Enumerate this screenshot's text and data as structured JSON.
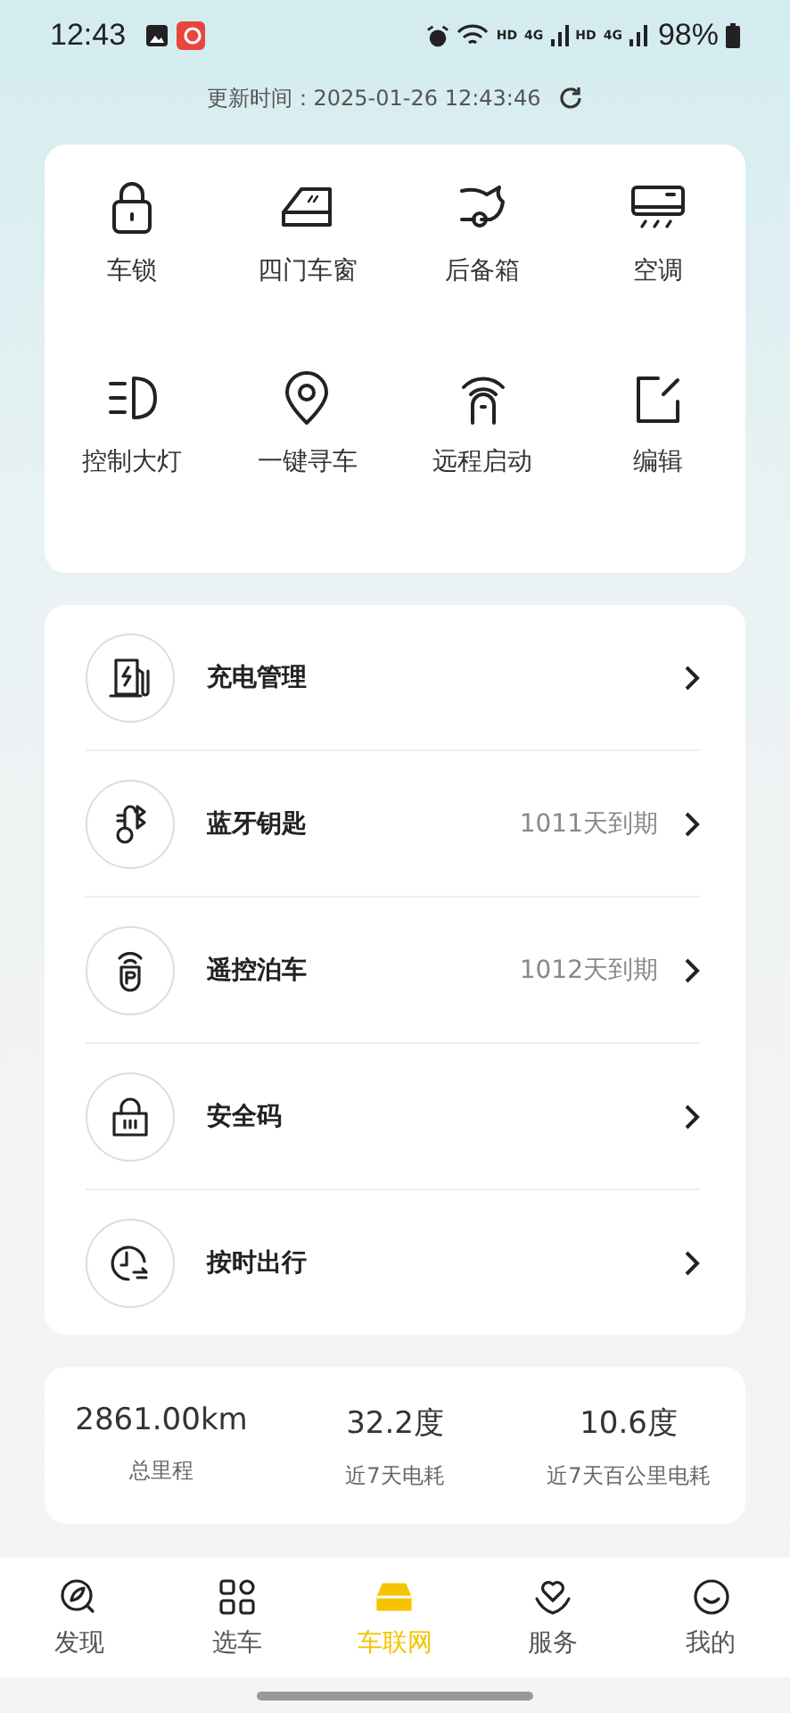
{
  "status_bar": {
    "time": "12:43",
    "battery": "98%",
    "network_labels": [
      "HD",
      "4G",
      "HD",
      "4G"
    ]
  },
  "update_time": {
    "label": "更新时间：2025-01-26 12:43:46"
  },
  "controls": [
    {
      "label": "车锁"
    },
    {
      "label": "四门车窗"
    },
    {
      "label": "后备箱"
    },
    {
      "label": "空调"
    },
    {
      "label": "控制大灯"
    },
    {
      "label": "一键寻车"
    },
    {
      "label": "远程启动"
    },
    {
      "label": "编辑"
    }
  ],
  "services": [
    {
      "label": "充电管理"
    },
    {
      "label": "蓝牙钥匙",
      "note": "1011天到期"
    },
    {
      "label": "遥控泊车",
      "note": "1012天到期"
    },
    {
      "label": "安全码"
    },
    {
      "label": "按时出行"
    }
  ],
  "stats": [
    {
      "value": "2861.00km",
      "label": "总里程"
    },
    {
      "value": "32.2度",
      "label": "近7天电耗"
    },
    {
      "value": "10.6度",
      "label": "近7天百公里电耗"
    }
  ],
  "tab_bar": [
    {
      "label": "发现",
      "selected": false
    },
    {
      "label": "选车",
      "selected": false
    },
    {
      "label": "车联网",
      "selected": true
    },
    {
      "label": "服务",
      "selected": false
    },
    {
      "label": "我的",
      "selected": false
    }
  ]
}
